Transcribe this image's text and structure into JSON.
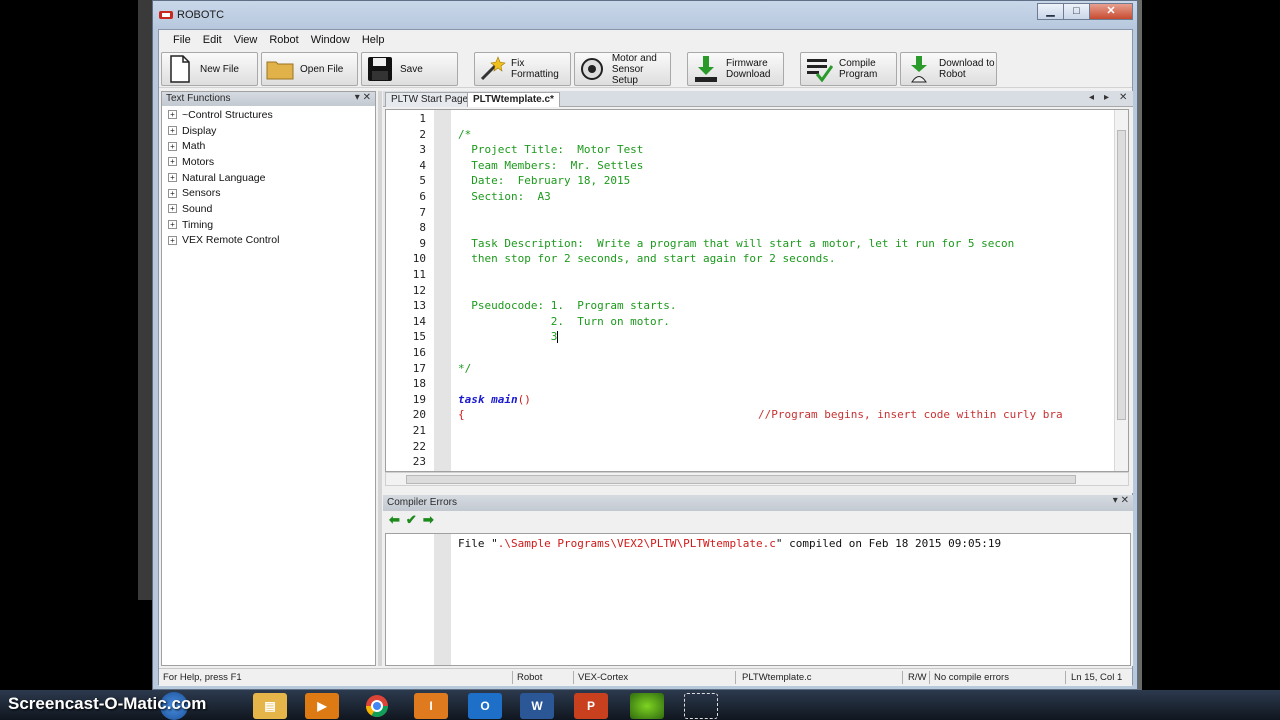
{
  "window": {
    "title": "ROBOTC"
  },
  "menu": [
    "File",
    "Edit",
    "View",
    "Robot",
    "Window",
    "Help"
  ],
  "toolbar": {
    "new_file": "New File",
    "open_file": "Open File",
    "save": "Save",
    "fix_formatting": "Fix Formatting",
    "motor_setup_1": "Motor and",
    "motor_setup_2": "Sensor Setup",
    "firmware_1": "Firmware",
    "firmware_2": "Download",
    "compile_1": "Compile",
    "compile_2": "Program",
    "download_1": "Download to",
    "download_2": "Robot"
  },
  "text_functions": {
    "title": "Text Functions",
    "items": [
      "~Control Structures",
      "Display",
      "Math",
      "Motors",
      "Natural Language",
      "Sensors",
      "Sound",
      "Timing",
      "VEX Remote Control"
    ]
  },
  "tabs": [
    "PLTW Start Page",
    "PLTWtemplate.c*"
  ],
  "code_lines": [
    {
      "n": "1",
      "t": ""
    },
    {
      "n": "2",
      "t": "/*"
    },
    {
      "n": "3",
      "t": "  Project Title:  Motor Test"
    },
    {
      "n": "4",
      "t": "  Team Members:  Mr. Settles"
    },
    {
      "n": "5",
      "t": "  Date:  February 18, 2015"
    },
    {
      "n": "6",
      "t": "  Section:  A3"
    },
    {
      "n": "7",
      "t": ""
    },
    {
      "n": "8",
      "t": ""
    },
    {
      "n": "9",
      "t": "  Task Description:  Write a program that will start a motor, let it run for 5 secon"
    },
    {
      "n": "10",
      "t": "  then stop for 2 seconds, and start again for 2 seconds."
    },
    {
      "n": "11",
      "t": ""
    },
    {
      "n": "12",
      "t": ""
    },
    {
      "n": "13",
      "t": "  Pseudocode: 1.  Program starts."
    },
    {
      "n": "14",
      "t": "              2.  Turn on motor."
    },
    {
      "n": "15",
      "t": "              3"
    },
    {
      "n": "16",
      "t": ""
    },
    {
      "n": "17",
      "t": "*/"
    },
    {
      "n": "18",
      "t": ""
    },
    {
      "n": "19",
      "t": ""
    },
    {
      "n": "20",
      "t": ""
    },
    {
      "n": "21",
      "t": ""
    },
    {
      "n": "22",
      "t": ""
    },
    {
      "n": "23",
      "t": ""
    }
  ],
  "task_main": {
    "keyword": "task main",
    "parens": "()"
  },
  "line20": {
    "brace": "{",
    "comment": "//Program begins, insert code within curly bra"
  },
  "compiler": {
    "title": "Compiler Errors",
    "msg_pre": "File \"",
    "msg_path": ".\\Sample Programs\\VEX2\\PLTW\\PLTWtemplate.c",
    "msg_post": "\" compiled on Feb 18 2015 09:05:19"
  },
  "status": {
    "help": "For Help, press F1",
    "robot": "Robot",
    "platform": "VEX-Cortex",
    "file": "PLTWtemplate.c",
    "mode": "R/W",
    "errors": "No compile errors",
    "position": "Ln 15, Col 1"
  },
  "watermark": "Screencast-O-Matic.com",
  "colors": {
    "comment": "#1c9a1c",
    "keyword": "#1a1ad0",
    "path": "#d01a1a"
  }
}
